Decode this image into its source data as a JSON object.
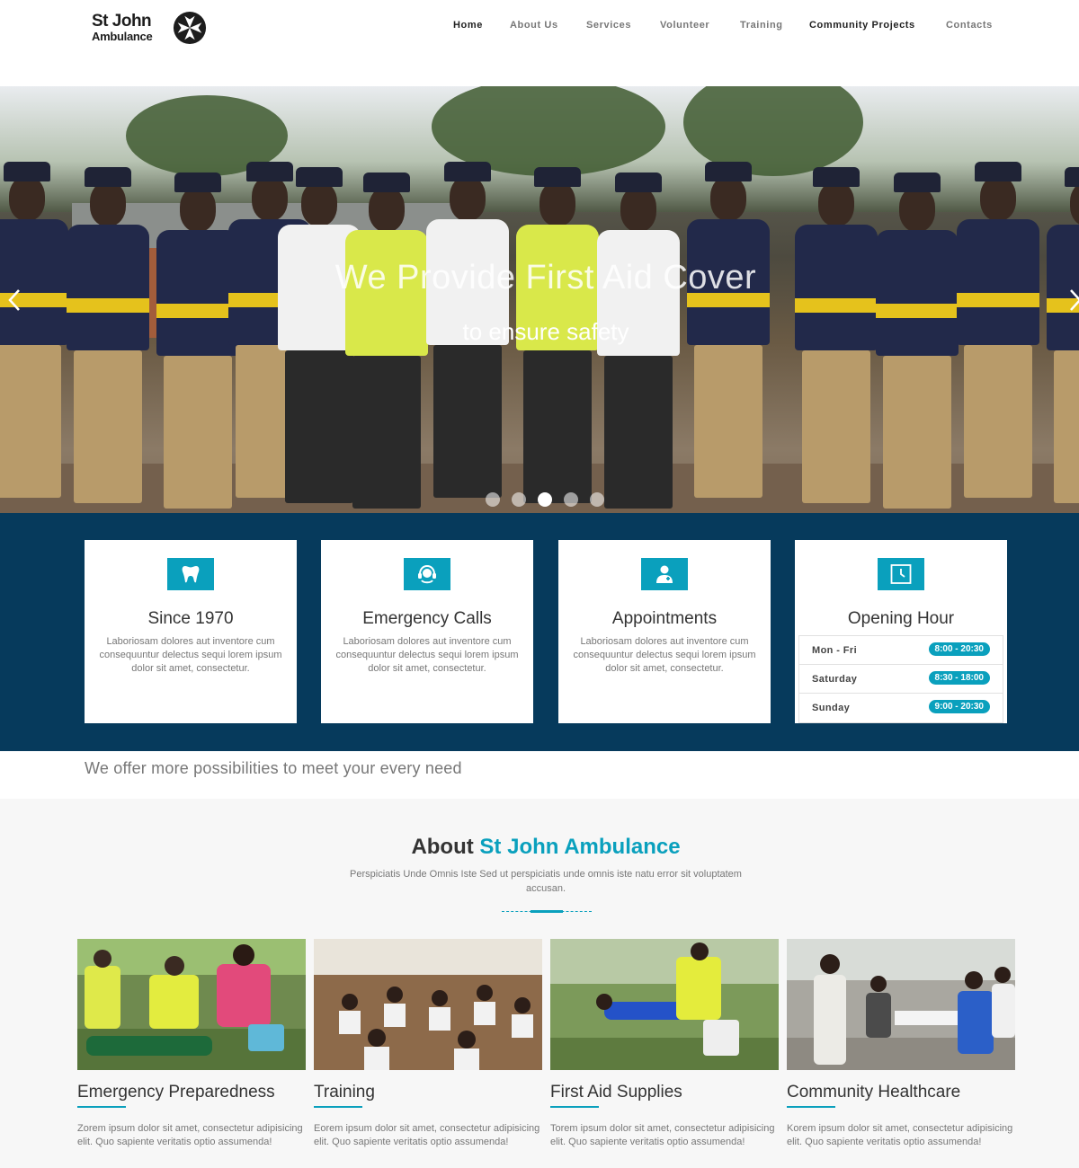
{
  "brand": {
    "line1": "St John",
    "line2": "Ambulance"
  },
  "nav": [
    {
      "label": "Home"
    },
    {
      "label": "About Us"
    },
    {
      "label": "Services"
    },
    {
      "label": "Volunteer"
    },
    {
      "label": "Training"
    },
    {
      "label": "Community Projects"
    },
    {
      "label": "Contacts"
    }
  ],
  "hero": {
    "title": "We Provide First Aid Cover",
    "subtitle": "to ensure safety",
    "prev_icon": "chevron-left-icon",
    "next_icon": "chevron-right-icon",
    "slides": 5,
    "active_slide": 3
  },
  "features": [
    {
      "icon": "tooth-icon",
      "title": "Since 1970",
      "text": "Laboriosam dolores aut inventore cum consequuntur delectus sequi lorem ipsum dolor sit amet, consectetur."
    },
    {
      "icon": "headset-icon",
      "title": "Emergency Calls",
      "text": "Laboriosam dolores aut inventore cum consequuntur delectus sequi lorem ipsum dolor sit amet, consectetur."
    },
    {
      "icon": "doctor-icon",
      "title": "Appointments",
      "text": "Laboriosam dolores aut inventore cum consequuntur delectus sequi lorem ipsum dolor sit amet, consectetur."
    }
  ],
  "opening": {
    "icon": "clock-icon",
    "title": "Opening Hour",
    "rows": [
      {
        "day": "Mon - Fri",
        "hours": "8:00 - 20:30"
      },
      {
        "day": "Saturday",
        "hours": "8:30 - 18:00"
      },
      {
        "day": "Sunday",
        "hours": "9:00 - 20:30"
      }
    ]
  },
  "tagline": "We offer more possibilities to meet your every need",
  "about": {
    "title_prefix": "About",
    "title_highlight": "St John Ambulance",
    "description": "Perspiciatis Unde Omnis Iste Sed ut perspiciatis unde omnis iste natu error sit voluptatem accusan.",
    "cards": [
      {
        "title": "Emergency Preparedness",
        "text": "Zorem ipsum dolor sit amet, consectetur adipisicing elit. Quo sapiente veritatis optio assumenda!"
      },
      {
        "title": "Training",
        "text": "Eorem ipsum dolor sit amet, consectetur adipisicing elit. Quo sapiente veritatis optio assumenda!"
      },
      {
        "title": "First Aid Supplies",
        "text": "Torem ipsum dolor sit amet, consectetur adipisicing elit. Quo sapiente veritatis optio assumenda!"
      },
      {
        "title": "Community Healthcare",
        "text": "Korem ipsum dolor sit amet, consectetur adipisicing elit. Quo sapiente veritatis optio assumenda!"
      }
    ]
  },
  "colors": {
    "accent": "#0aa0bd",
    "band": "#063a5c"
  }
}
